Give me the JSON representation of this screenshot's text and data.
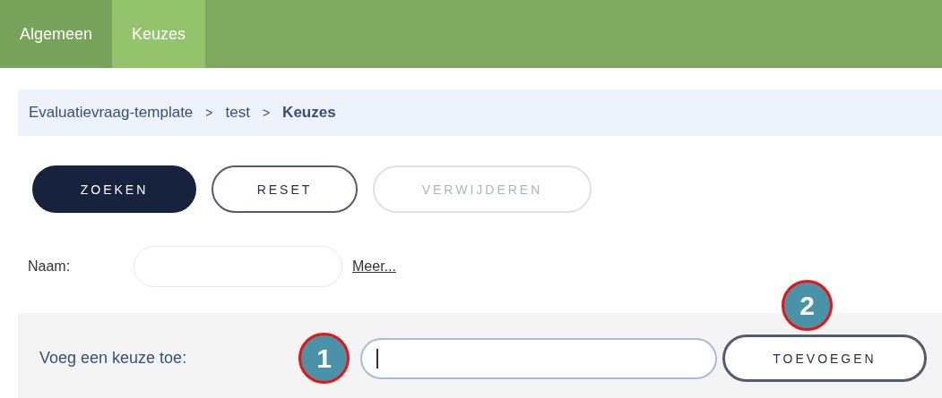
{
  "tabs": [
    {
      "label": "Algemeen",
      "selected": false
    },
    {
      "label": "Keuzes",
      "selected": true
    }
  ],
  "breadcrumb": [
    {
      "label": "Evaluatievraag-template",
      "current": false
    },
    {
      "label": "test",
      "current": false
    },
    {
      "label": "Keuzes",
      "current": true
    }
  ],
  "breadcrumb_separator": ">",
  "buttons": [
    {
      "label": "ZOEKEN",
      "kind": "primary",
      "disabled": false
    },
    {
      "label": "RESET",
      "kind": "outline",
      "disabled": false
    },
    {
      "label": "VERWIJDEREN",
      "kind": "outline",
      "disabled": true
    }
  ],
  "filter": {
    "label": "Naam:",
    "link": "Meer..."
  },
  "add_choice": {
    "label": "Voeg een keuze toe:",
    "field_badge": "1",
    "button": "TOEVOEGEN",
    "button_badge": "2"
  }
}
